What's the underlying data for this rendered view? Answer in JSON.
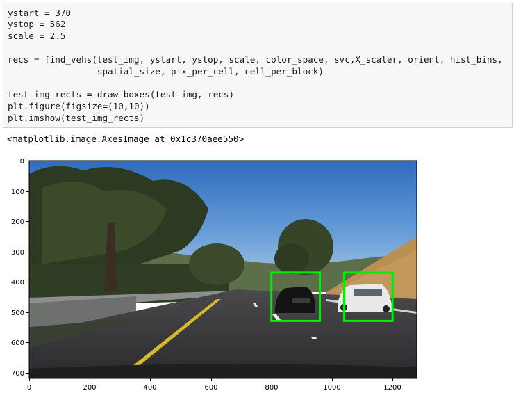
{
  "code_cell": {
    "lines": [
      "ystart = 370",
      "ystop = 562",
      "scale = 2.5",
      "",
      "recs = find_vehs(test_img, ystart, ystop, scale, color_space, svc,X_scaler, orient, hist_bins,",
      "                 spatial_size, pix_per_cell, cell_per_block)",
      "",
      "test_img_rects = draw_boxes(test_img, recs)",
      "plt.figure(figsize=(10,10))",
      "plt.imshow(test_img_rects)"
    ]
  },
  "output": {
    "text": "<matplotlib.image.AxesImage at 0x1c370aee550>"
  },
  "plot": {
    "x_ticks": [
      "0",
      "200",
      "400",
      "600",
      "800",
      "1000",
      "1200"
    ],
    "y_ticks": [
      "0",
      "100",
      "200",
      "300",
      "400",
      "500",
      "600",
      "700"
    ],
    "xlim": [
      0,
      1280
    ],
    "ylim": [
      0,
      720
    ],
    "box_color": "#00ee00",
    "boxes": [
      {
        "x1": 800,
        "y1": 370,
        "x2": 960,
        "y2": 530,
        "label": "left-car-detection-box"
      },
      {
        "x1": 1040,
        "y1": 370,
        "x2": 1200,
        "y2": 530,
        "label": "right-car-detection-box"
      }
    ]
  }
}
